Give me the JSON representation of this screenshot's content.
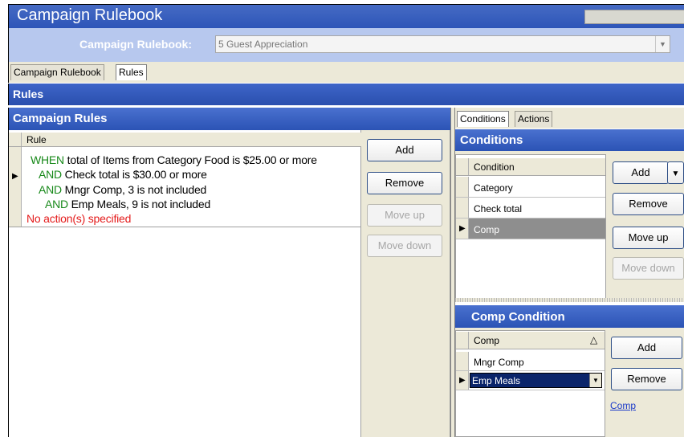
{
  "window": {
    "title": "Campaign Rulebook"
  },
  "rulebook_selector": {
    "label": "Campaign Rulebook:",
    "value": "5 Guest Appreciation"
  },
  "tabs": [
    {
      "label": "Campaign Rulebook"
    },
    {
      "label": "Rules"
    }
  ],
  "rules_section": {
    "title": "Rules"
  },
  "campaign_rules": {
    "title": "Campaign Rules",
    "column_header": "Rule",
    "rule": {
      "line1": {
        "keyword": "WHEN",
        "text": " total of Items from Category Food is $25.00 or more"
      },
      "line2": {
        "keyword": "AND",
        "text": " Check total is $30.00 or more"
      },
      "line3": {
        "keyword": "AND",
        "text": " Mngr Comp, 3 is not included"
      },
      "line4": {
        "keyword": "AND",
        "text": " Emp Meals, 9 is not included"
      },
      "line5": {
        "text": "No action(s) specified"
      }
    },
    "buttons": {
      "add": "Add",
      "remove": "Remove",
      "move_up": "Move up",
      "move_down": "Move down"
    }
  },
  "right_tabs": [
    {
      "label": "Conditions"
    },
    {
      "label": "Actions"
    }
  ],
  "conditions": {
    "title": "Conditions",
    "column_header": "Condition",
    "rows": [
      "Category",
      "Check total",
      "Comp"
    ],
    "buttons": {
      "add": "Add",
      "remove": "Remove",
      "move_up": "Move up",
      "move_down": "Move down"
    }
  },
  "comp_condition": {
    "title": "Comp Condition",
    "column_header": "Comp",
    "rows": [
      "Mngr Comp",
      "Emp Meals"
    ],
    "buttons": {
      "add": "Add",
      "remove": "Remove"
    },
    "link": "Comp"
  },
  "colors": {
    "header_blue": "#2d55b8",
    "keyword_green": "#18891a",
    "warning_red": "#e41b1b",
    "selected_row": "#0a246a"
  }
}
